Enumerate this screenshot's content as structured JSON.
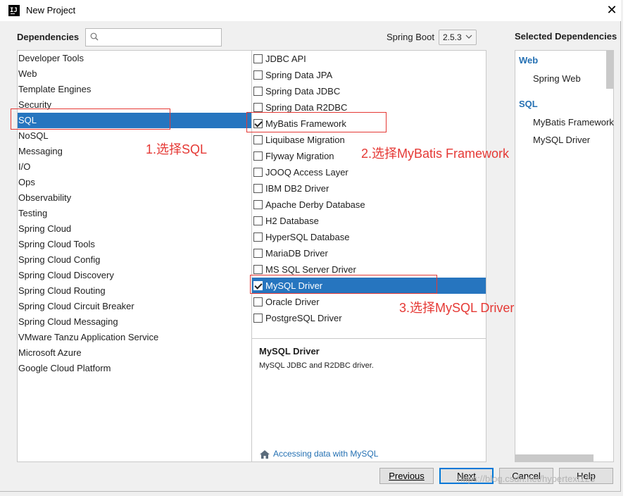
{
  "window": {
    "title": "New Project"
  },
  "header": {
    "dependencies_label": "Dependencies",
    "search_placeholder": "",
    "spring_boot_label": "Spring Boot",
    "spring_boot_version": "2.5.3"
  },
  "categories": [
    "Developer Tools",
    "Web",
    "Template Engines",
    "Security",
    "SQL",
    "NoSQL",
    "Messaging",
    "I/O",
    "Ops",
    "Observability",
    "Testing",
    "Spring Cloud",
    "Spring Cloud Tools",
    "Spring Cloud Config",
    "Spring Cloud Discovery",
    "Spring Cloud Routing",
    "Spring Cloud Circuit Breaker",
    "Spring Cloud Messaging",
    "VMware Tanzu Application Service",
    "Microsoft Azure",
    "Google Cloud Platform"
  ],
  "selected_category_index": 4,
  "dependencies": [
    {
      "label": "JDBC API",
      "checked": false
    },
    {
      "label": "Spring Data JPA",
      "checked": false
    },
    {
      "label": "Spring Data JDBC",
      "checked": false
    },
    {
      "label": "Spring Data R2DBC",
      "checked": false
    },
    {
      "label": "MyBatis Framework",
      "checked": true
    },
    {
      "label": "Liquibase Migration",
      "checked": false
    },
    {
      "label": "Flyway Migration",
      "checked": false
    },
    {
      "label": "JOOQ Access Layer",
      "checked": false
    },
    {
      "label": "IBM DB2 Driver",
      "checked": false
    },
    {
      "label": "Apache Derby Database",
      "checked": false
    },
    {
      "label": "H2 Database",
      "checked": false
    },
    {
      "label": "HyperSQL Database",
      "checked": false
    },
    {
      "label": "MariaDB Driver",
      "checked": false
    },
    {
      "label": "MS SQL Server Driver",
      "checked": false
    },
    {
      "label": "MySQL Driver",
      "checked": true
    },
    {
      "label": "Oracle Driver",
      "checked": false
    },
    {
      "label": "PostgreSQL Driver",
      "checked": false
    }
  ],
  "selected_dependency_index": 14,
  "description": {
    "title": "MySQL Driver",
    "text": "MySQL JDBC and R2DBC driver.",
    "link": "Accessing data with MySQL"
  },
  "selected_panel": {
    "title": "Selected Dependencies",
    "groups": [
      {
        "name": "Web",
        "items": [
          "Spring Web"
        ]
      },
      {
        "name": "SQL",
        "items": [
          "MyBatis Framework",
          "MySQL Driver"
        ]
      }
    ]
  },
  "buttons": {
    "previous": "Previous",
    "next": "Next",
    "cancel": "Cancel",
    "help": "Help"
  },
  "annotations": {
    "step1": "1.选择SQL",
    "step2": "2.选择MyBatis Framework",
    "step3": "3.选择MySQL Driver"
  },
  "watermark": "https://blog.csdn.net/hypertext123",
  "colors": {
    "selection": "#2675bf",
    "link": "#2470b3",
    "annotation": "#e53935"
  }
}
